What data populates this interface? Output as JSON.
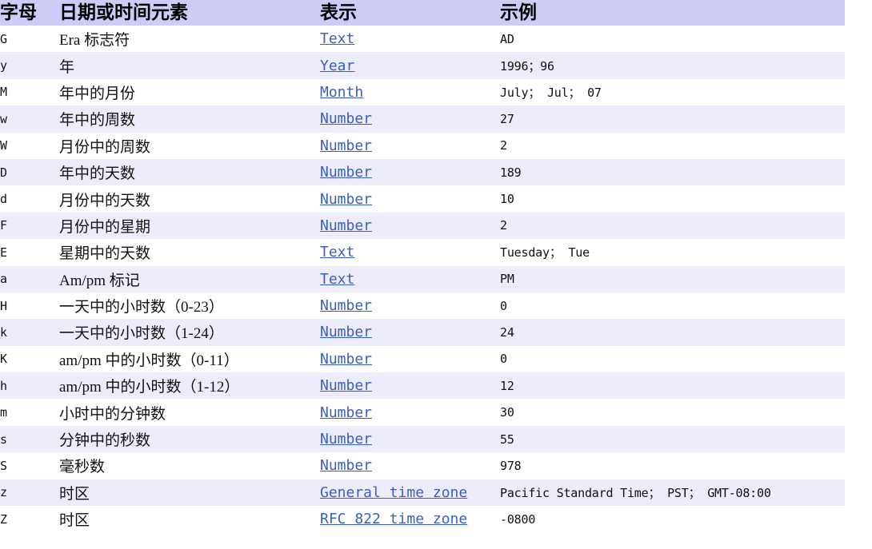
{
  "table": {
    "headers": {
      "letter": "字母",
      "element": "日期或时间元素",
      "presentation": "表示",
      "example": "示例"
    },
    "rows": [
      {
        "letter": "G",
        "element": "Era 标志符",
        "presentation": "Text",
        "example": "AD"
      },
      {
        "letter": "y",
        "element": "年",
        "presentation": "Year",
        "example": "1996；96"
      },
      {
        "letter": "M",
        "element": "年中的月份",
        "presentation": "Month",
        "example": "July； Jul； 07"
      },
      {
        "letter": "w",
        "element": "年中的周数",
        "presentation": "Number",
        "example": "27"
      },
      {
        "letter": "W",
        "element": "月份中的周数",
        "presentation": "Number",
        "example": "2"
      },
      {
        "letter": "D",
        "element": "年中的天数",
        "presentation": "Number",
        "example": "189"
      },
      {
        "letter": "d",
        "element": "月份中的天数",
        "presentation": "Number",
        "example": "10"
      },
      {
        "letter": "F",
        "element": "月份中的星期",
        "presentation": "Number",
        "example": "2"
      },
      {
        "letter": "E",
        "element": "星期中的天数",
        "presentation": "Text",
        "example": "Tuesday； Tue"
      },
      {
        "letter": "a",
        "element": "Am/pm 标记",
        "presentation": "Text",
        "example": "PM"
      },
      {
        "letter": "H",
        "element": "一天中的小时数（0-23）",
        "presentation": "Number",
        "example": "0"
      },
      {
        "letter": "k",
        "element": "一天中的小时数（1-24）",
        "presentation": "Number",
        "example": "24"
      },
      {
        "letter": "K",
        "element": "am/pm 中的小时数（0-11）",
        "presentation": "Number",
        "example": "0"
      },
      {
        "letter": "h",
        "element": "am/pm 中的小时数（1-12）",
        "presentation": "Number",
        "example": "12"
      },
      {
        "letter": "m",
        "element": "小时中的分钟数",
        "presentation": "Number",
        "example": "30"
      },
      {
        "letter": "s",
        "element": "分钟中的秒数",
        "presentation": "Number",
        "example": "55"
      },
      {
        "letter": "S",
        "element": "毫秒数",
        "presentation": "Number",
        "example": "978"
      },
      {
        "letter": "z",
        "element": "时区",
        "presentation": "General time zone",
        "example": "Pacific Standard Time； PST； GMT-08:00"
      },
      {
        "letter": "Z",
        "element": "时区",
        "presentation": "RFC 822 time zone",
        "example": "-0800"
      }
    ]
  },
  "colors": {
    "header_background": "#ccccf7",
    "stripe_background": "#ececfa",
    "row_background": "#ffffff",
    "link": "#3b5fc0",
    "text": "#111111"
  }
}
